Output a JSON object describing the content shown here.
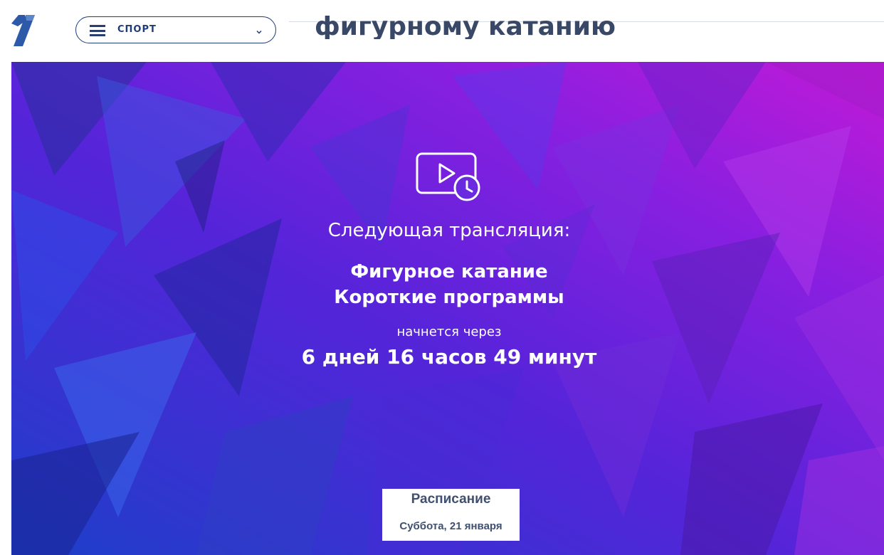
{
  "header": {
    "logo_icon": "channel-one-logo",
    "section_select": {
      "menu_icon": "menu-icon",
      "label": "СПОРТ",
      "chevron_icon": "chevron-down-icon"
    },
    "page_title": "фигурному катанию"
  },
  "player": {
    "icon": "video-schedule-icon",
    "next_label": "Следующая трансляция:",
    "event_name": "Фигурное катание",
    "event_program": "Короткие программы",
    "starts_in": "начнется через",
    "countdown": "6 дней 16 часов 49 минут"
  },
  "schedule": {
    "title": "Расписание",
    "date": "Суббота, 21 января"
  },
  "colors": {
    "brand_blue": "#1f3c78",
    "title_text": "#384866",
    "gradient_start": "#1d3fc9",
    "gradient_mid": "#6a22e6",
    "gradient_end": "#c11ad6"
  }
}
